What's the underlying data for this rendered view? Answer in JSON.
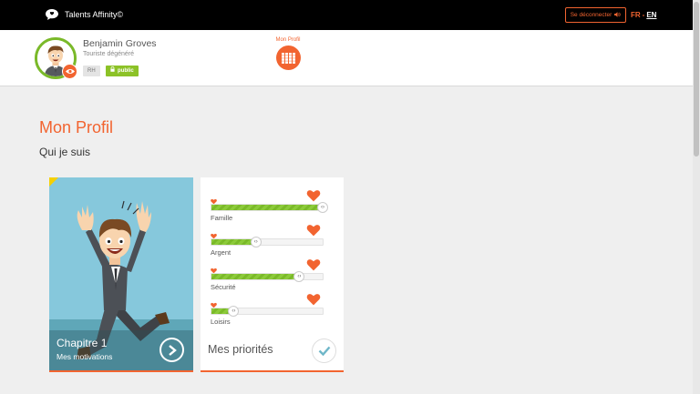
{
  "app": {
    "title": "Talents Affinity©"
  },
  "topbar": {
    "logout_label": "Se déconnecter",
    "lang_fr": "FR",
    "lang_sep": "-",
    "lang_en": "EN"
  },
  "profile": {
    "name": "Benjamin Groves",
    "title": "Touriste dégénéré",
    "tag_role": "RH",
    "tag_visibility": "public"
  },
  "nav": {
    "profile_label": "Mon Profil"
  },
  "main": {
    "page_title": "Mon Profil",
    "section_title": "Qui je suis"
  },
  "chapter_card": {
    "title": "Chapitre 1",
    "subtitle": "Mes motivations"
  },
  "priorities_card": {
    "title": "Mes priorités",
    "items": [
      {
        "label": "Famille",
        "level": 1.0
      },
      {
        "label": "Argent",
        "level": 0.4
      },
      {
        "label": "Sécurité",
        "level": 0.79
      },
      {
        "label": "Loisirs",
        "level": 0.2
      }
    ]
  },
  "colors": {
    "accent": "#f26430",
    "green": "#7ab929",
    "topbar": "#000000",
    "background": "#efefef"
  },
  "icons": {
    "brand": "chat-bubble-icon",
    "logout": "speaker-icon",
    "visibility": "eye-icon",
    "lock": "lock-icon",
    "grid": "grid-icon",
    "next": "chevron-right-icon",
    "check": "check-icon",
    "heart": "heart-icon"
  }
}
